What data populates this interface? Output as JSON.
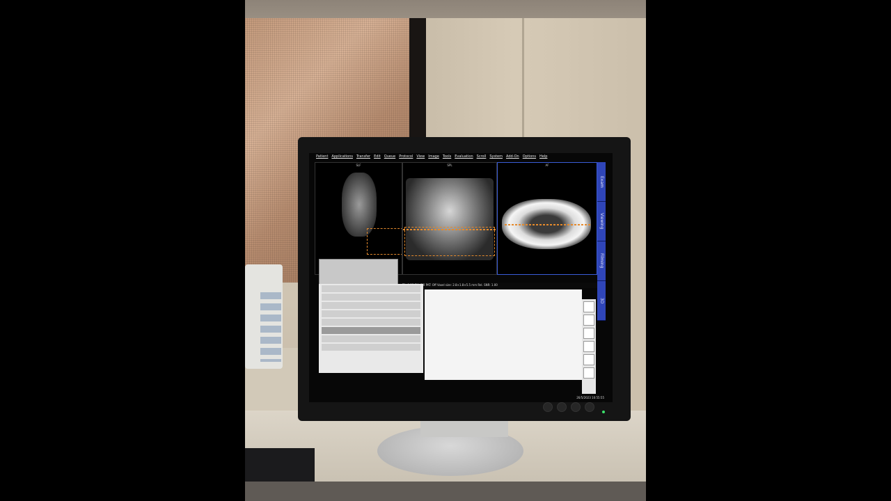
{
  "menu": [
    "Patient",
    "Applications",
    "Transfer",
    "Edit",
    "Queue",
    "Protocol",
    "View",
    "Image",
    "Tools",
    "Evaluation",
    "Scroll",
    "System",
    "Add-On",
    "Options",
    "Help"
  ],
  "side_tabs": [
    "Exam",
    "Viewing",
    "Filming",
    "3D"
  ],
  "viewports": [
    "SLF",
    "SPL",
    "AF"
  ],
  "info_bar": "TA: 8:35   PM: FIX   PAT: Off   Voxel size: 2.8×1.8×5.5 mm   Rel. SNR: 1.00",
  "clock": "26/5/2023 10:55:55",
  "colors": {
    "accent_blue": "#2f45b8",
    "slice_orange": "#e58a2c"
  }
}
